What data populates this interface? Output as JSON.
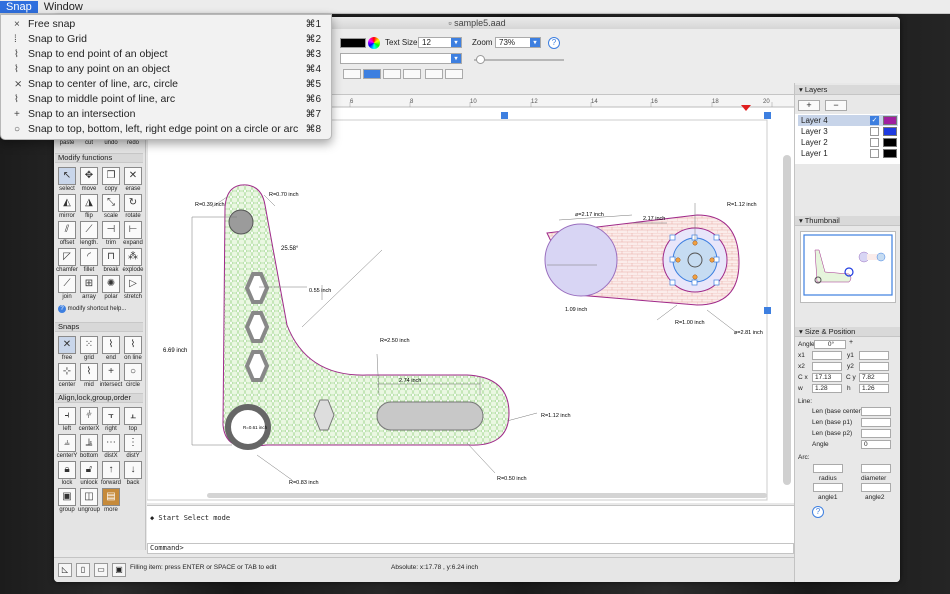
{
  "menubar": {
    "items": [
      "Snap",
      "Window"
    ]
  },
  "window": {
    "title": "sample5.aad"
  },
  "controls": {
    "text_size_label": "Text Size",
    "text_size_value": "12",
    "zoom_label": "Zoom",
    "zoom_value": "73%",
    "help": "?"
  },
  "snap_menu": {
    "items": [
      {
        "label": "Free snap",
        "shortcut": "⌘1",
        "icon": "×"
      },
      {
        "label": "Snap to Grid",
        "shortcut": "⌘2",
        "icon": "⁞"
      },
      {
        "label": "Snap to end point of an object",
        "shortcut": "⌘3",
        "icon": "⌇"
      },
      {
        "label": "Snap to any point on an object",
        "shortcut": "⌘4",
        "icon": "⌇"
      },
      {
        "label": "Snap to center of line, arc, circle",
        "shortcut": "⌘5",
        "icon": "⨯"
      },
      {
        "label": "Snap to middle point of line, arc",
        "shortcut": "⌘6",
        "icon": "⌇"
      },
      {
        "label": "Snap to an intersection",
        "shortcut": "⌘7",
        "icon": "+"
      },
      {
        "label": "Snap to top, bottom, left, right edge point on a circle or arc",
        "shortcut": "⌘8",
        "icon": "○"
      }
    ]
  },
  "palette": {
    "edit_row": [
      "paste",
      "cut",
      "undo",
      "redo"
    ],
    "modify_header": "Modify functions",
    "modify_tools": [
      "select",
      "move",
      "copy",
      "erase",
      "mirror",
      "flip",
      "scale",
      "rotate",
      "offset",
      "length.",
      "trim",
      "expand",
      "chamfer",
      "fillet",
      "break",
      "explode",
      "join",
      "array",
      "polar",
      "stretch"
    ],
    "modify_help": "modify shortcut help...",
    "snaps_header": "Snaps",
    "snap_tools": [
      "free",
      "grid",
      "end",
      "on line",
      "center",
      "mid",
      "intersect",
      "circle"
    ],
    "align_header": "Align,lock,group,order",
    "align_tools": [
      "left",
      "centerX",
      "right",
      "top",
      "centerY",
      "bottom",
      "distX",
      "distY",
      "lock",
      "unlock",
      "forward",
      "back",
      "group",
      "ungroup",
      "more"
    ]
  },
  "ruler": {
    "labels": [
      "4",
      "6",
      "8",
      "10",
      "12",
      "14",
      "16",
      "18",
      "20"
    ]
  },
  "drawing": {
    "labels": [
      "R=0.39 inch",
      "R=0.70 inch",
      "25.58°",
      "0.55 inch",
      "R=2.50 inch",
      "6.69 inch",
      "2.74 inch",
      "R=1.12 inch",
      "R=0.61 inch",
      "R=0.83 inch",
      "R=0.50 inch",
      "⌀=2.17 inch",
      "2.17 inch",
      "R=1.12 inch",
      "1.09 inch",
      "R=1.00 inch",
      "⌀=2.81 inch"
    ]
  },
  "console": {
    "line": "◆ Start Select mode",
    "command_prompt": "Command>"
  },
  "status": {
    "hint": "Filling item: press ENTER or SPACE or TAB to edit",
    "absolute": "Absolute: x:17.78 , y:6.24 inch"
  },
  "layers": {
    "header": "Layers",
    "add": "+",
    "remove": "−",
    "items": [
      {
        "name": "Layer 4",
        "visible": "✓",
        "color": "#a020a0"
      },
      {
        "name": "Layer 3",
        "visible": "",
        "color": "#1f3be0"
      },
      {
        "name": "Layer 2",
        "visible": "",
        "color": "#000000"
      },
      {
        "name": "Layer 1",
        "visible": "",
        "color": "#000000"
      }
    ]
  },
  "thumbnail": {
    "header": "Thumbnail"
  },
  "size_position": {
    "header": "Size & Position",
    "angle_label": "Angle",
    "angle_value": "0°",
    "x1": "x1",
    "y1": "y1",
    "x2": "x2",
    "y2": "y2",
    "cx_label": "C x",
    "cx_value": "17.13",
    "cy_label": "C y",
    "cy_value": "7.82",
    "w_label": "w",
    "w_value": "1.28",
    "h_label": "h",
    "h_value": "1.26",
    "line_header": "Line:",
    "len_center": "Len (base center)",
    "len_p1": "Len (base p1)",
    "len_p2": "Len (base p2)",
    "line_angle_label": "Angle",
    "line_angle_value": "0",
    "arc_header": "Arc:",
    "radius": "radius",
    "diameter": "diameter",
    "angle1": "angle1",
    "angle2": "angle2",
    "help": "?"
  }
}
